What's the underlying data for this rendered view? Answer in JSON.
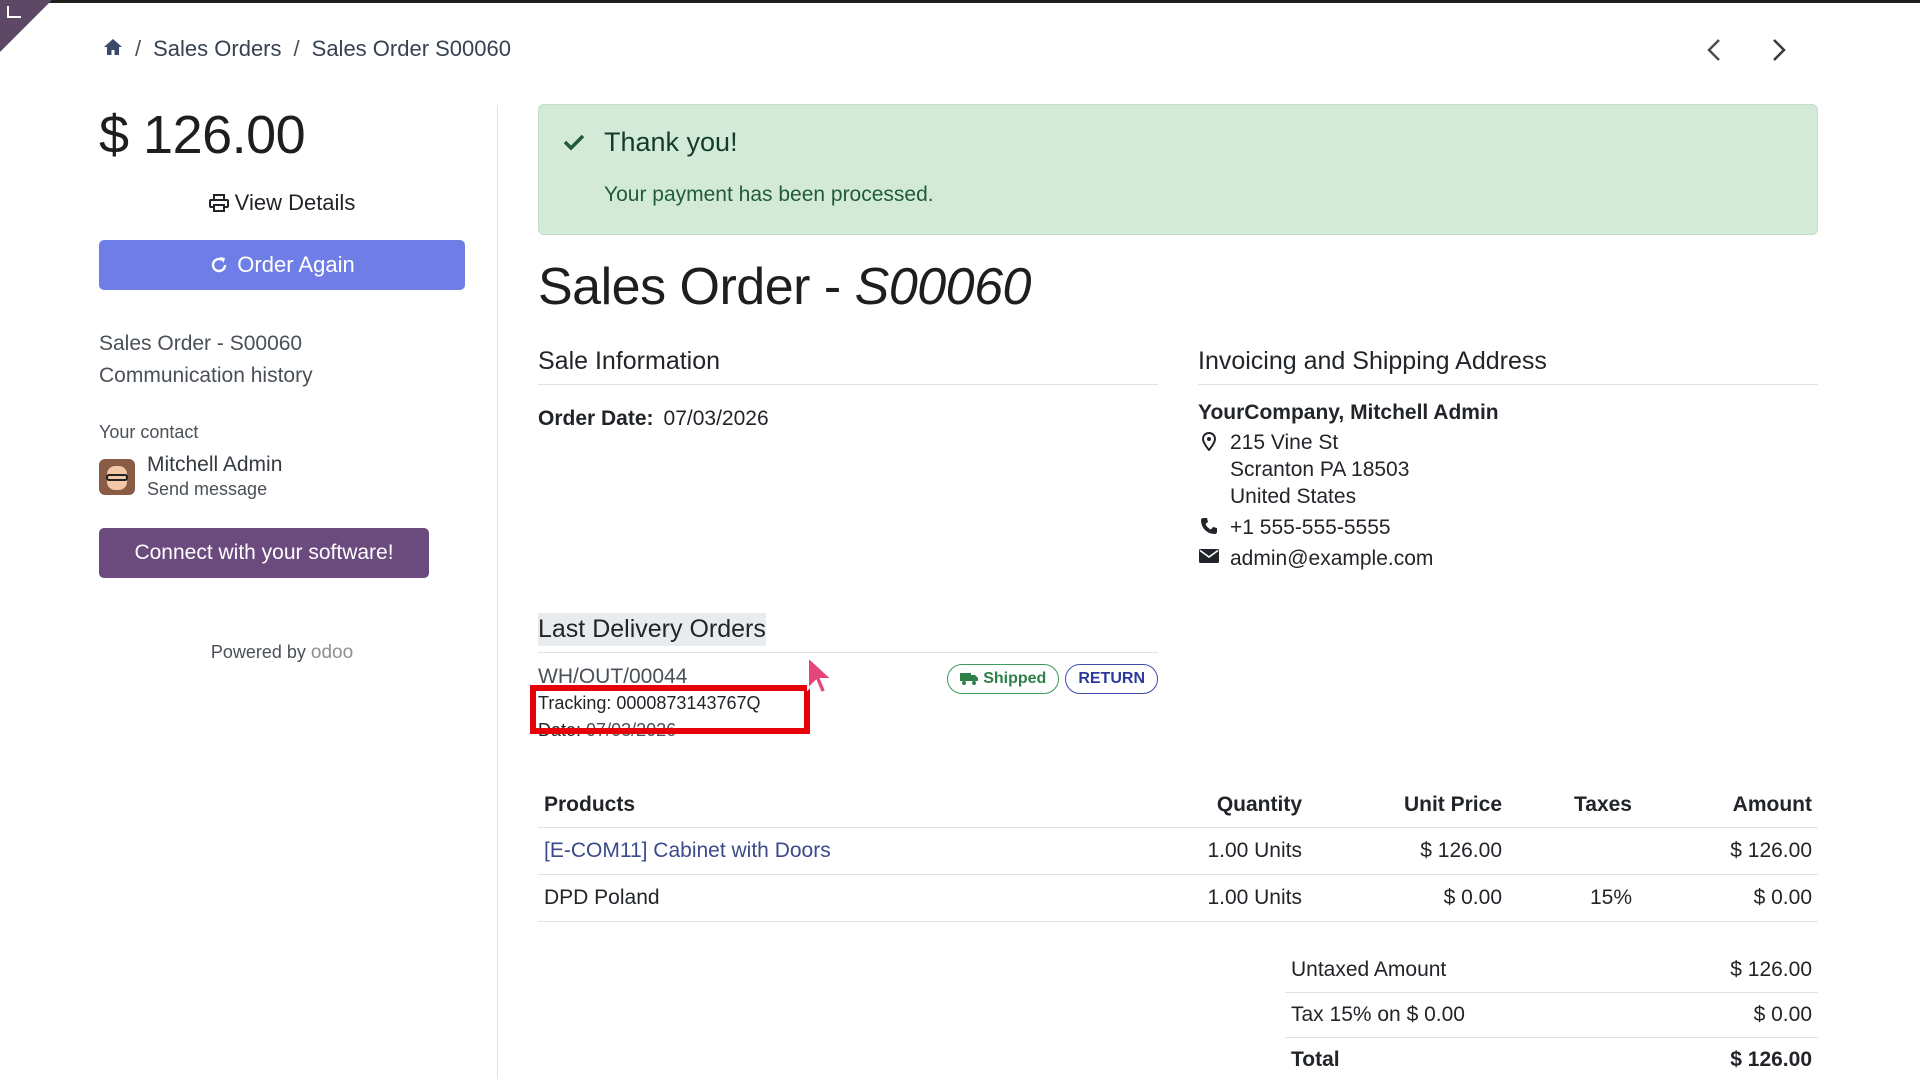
{
  "breadcrumb": {
    "items": [
      "Sales Orders",
      "Sales Order S00060"
    ]
  },
  "sidebar": {
    "amount": "$ 126.00",
    "view_details": "View Details",
    "order_again": "Order Again",
    "link_order": "Sales Order - S00060",
    "link_history": "Communication history",
    "contact_label": "Your contact",
    "contact_name": "Mitchell Admin",
    "contact_send": "Send message",
    "connect_button": "Connect with your software!",
    "powered_by": "Powered by",
    "odoo_logo": "odoo"
  },
  "alert": {
    "title": "Thank you!",
    "message": "Your payment has been processed."
  },
  "order": {
    "title_prefix": "Sales Order - ",
    "title_number": "S00060"
  },
  "sale_info": {
    "heading": "Sale Information",
    "order_date_label": "Order Date:",
    "order_date": "07/03/2026"
  },
  "address": {
    "heading": "Invoicing and Shipping Address",
    "name": "YourCompany, Mitchell Admin",
    "street": "215 Vine St",
    "city": "Scranton PA 18503",
    "country": "United States",
    "phone": "+1 555-555-5555",
    "email": "admin@example.com"
  },
  "delivery": {
    "heading": "Last Delivery Orders",
    "reference": "WH/OUT/00044",
    "tracking": "Tracking: 0000873143767Q",
    "date_label": "Date:",
    "date": "07/03/2026",
    "status_badge": "Shipped",
    "return_badge": "RETURN"
  },
  "lines": {
    "headers": [
      "Products",
      "Quantity",
      "Unit Price",
      "Taxes",
      "Amount"
    ],
    "rows": [
      {
        "product": "[E-COM11] Cabinet with Doors",
        "qty": "1.00 Units",
        "unit_price": "$ 126.00",
        "taxes": "",
        "amount": "$ 126.00"
      },
      {
        "product": "DPD Poland",
        "qty": "1.00 Units",
        "unit_price": "$ 0.00",
        "taxes": "15%",
        "amount": "$ 0.00"
      }
    ]
  },
  "totals": {
    "untaxed_label": "Untaxed Amount",
    "untaxed": "$ 126.00",
    "tax_label": "Tax 15% on $ 0.00",
    "tax": "$ 0.00",
    "total_label": "Total",
    "total": "$ 126.00"
  },
  "colors": {
    "primary": "#6f7ee6",
    "purple": "#6b4a7e",
    "success_bg": "#d4ead9",
    "highlight": "#e5000a"
  }
}
